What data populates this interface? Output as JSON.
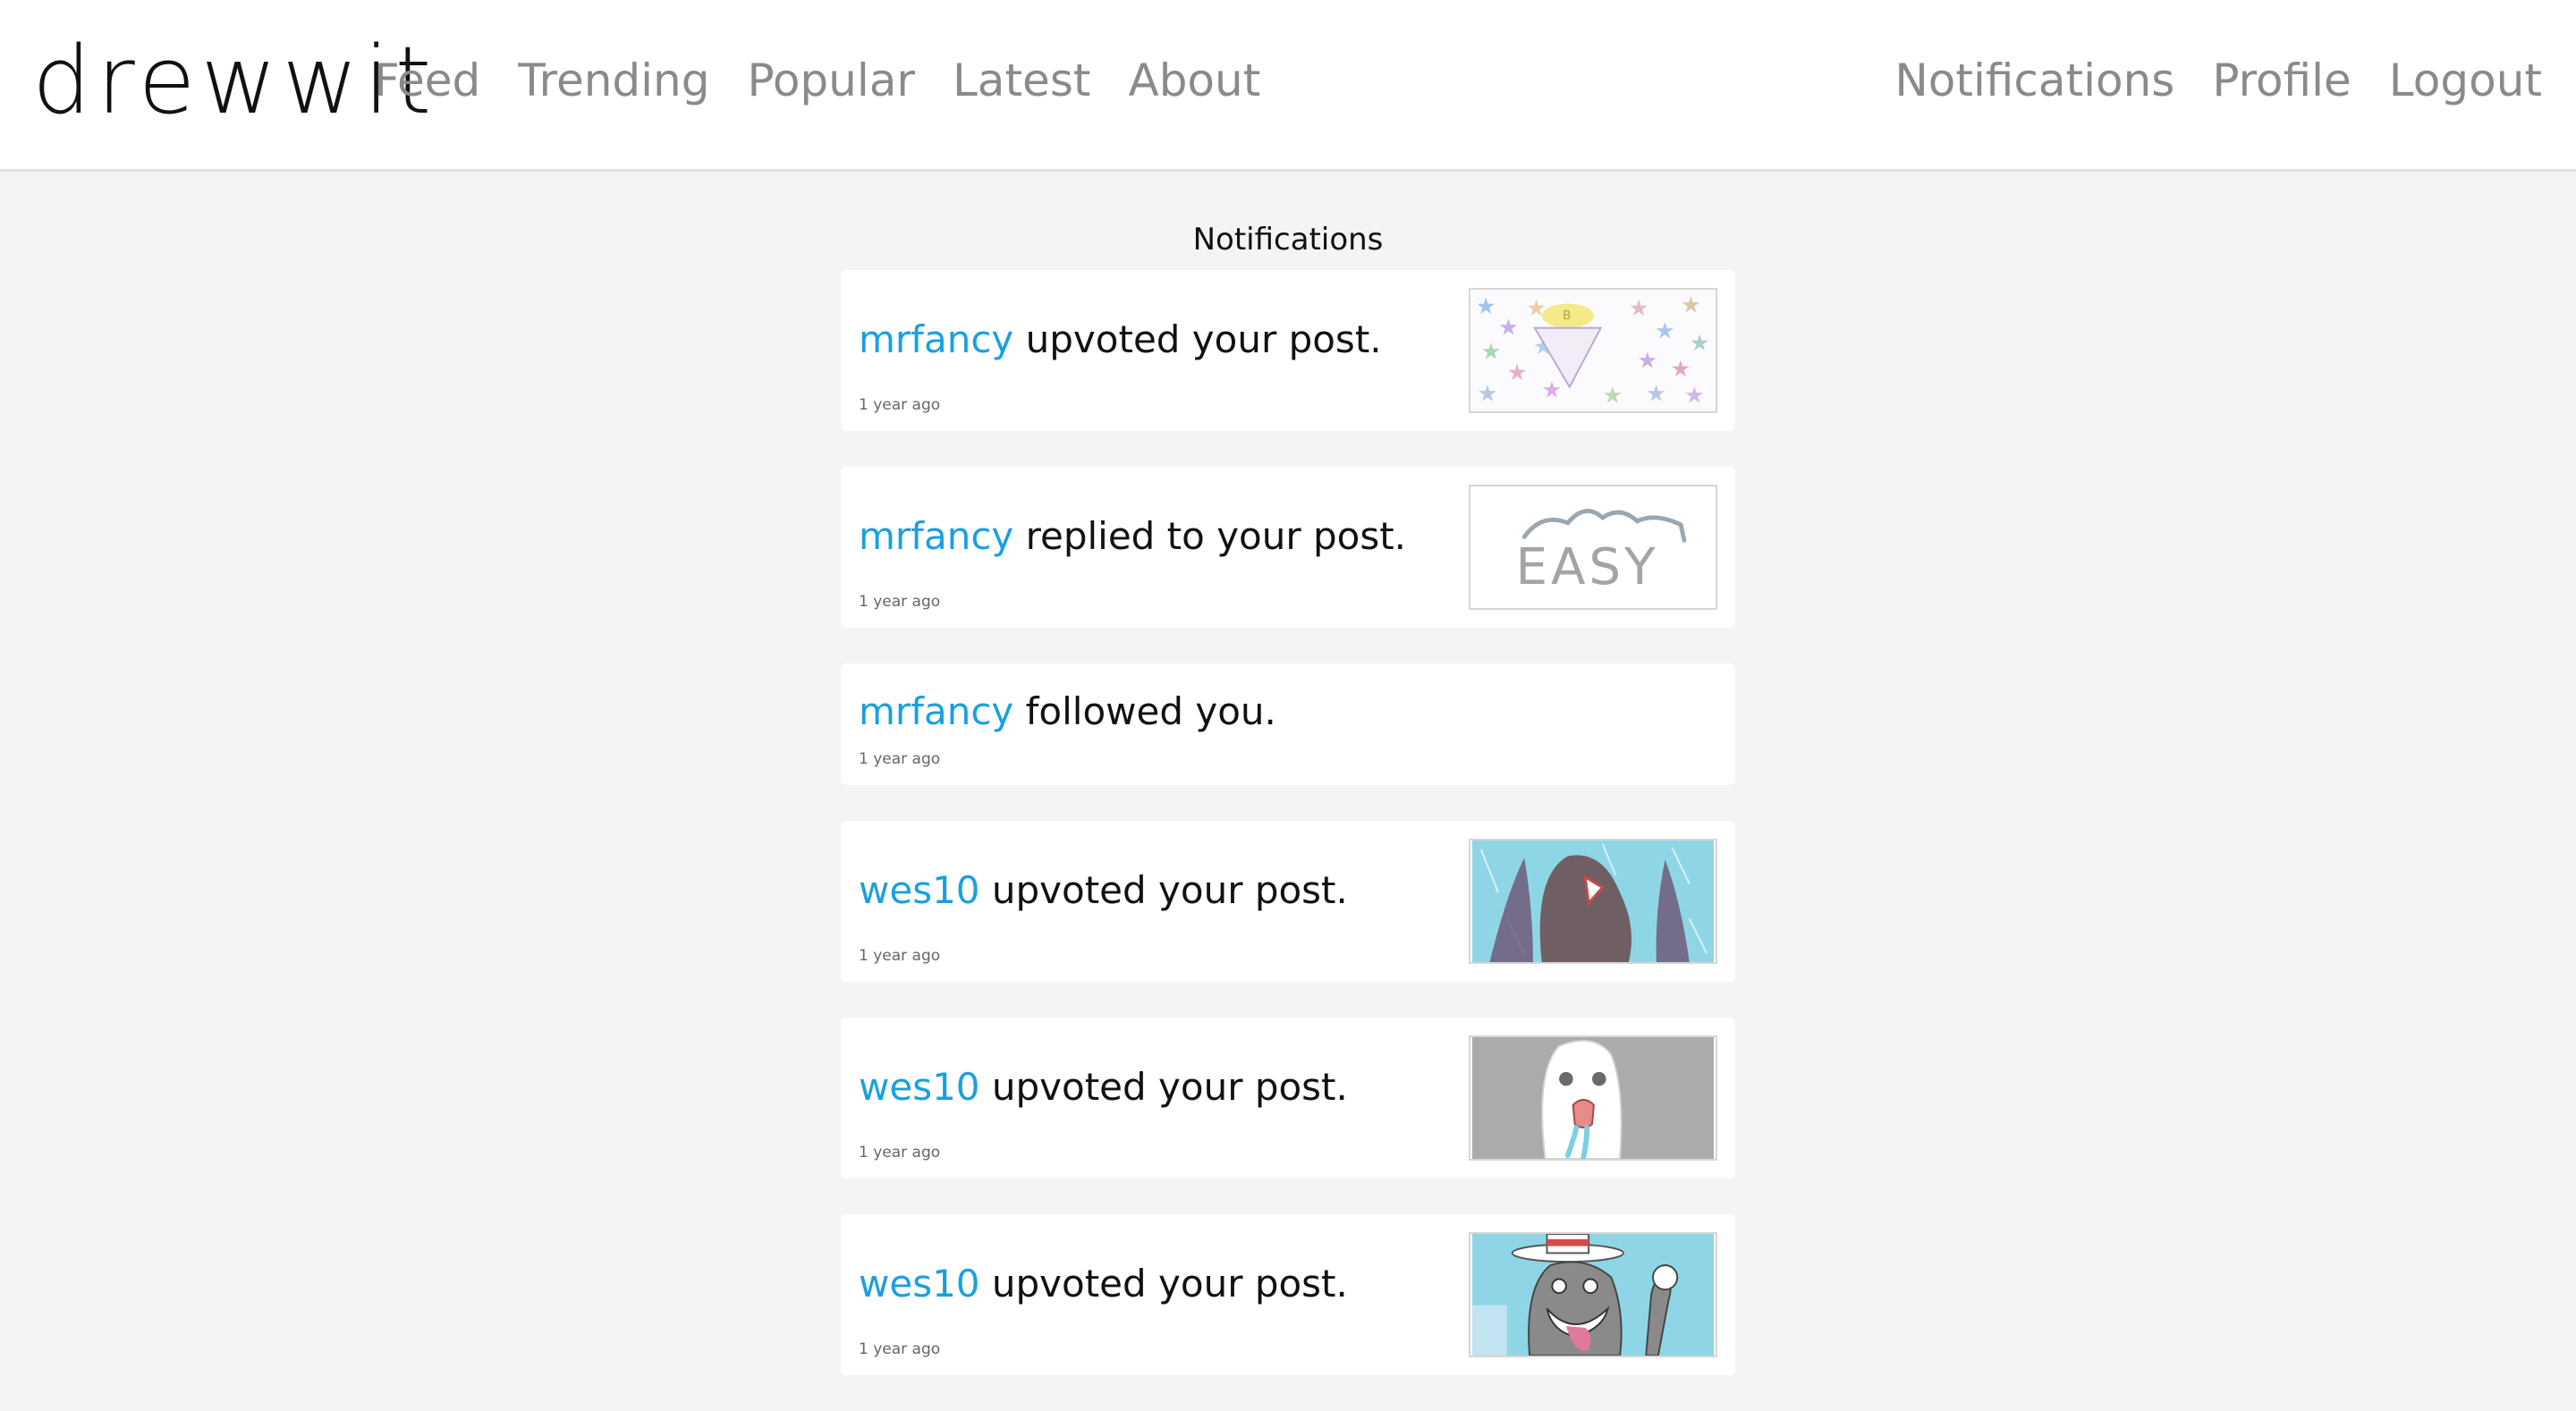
{
  "brand": {
    "name": "drewwit"
  },
  "nav": {
    "left": [
      "Feed",
      "Trending",
      "Popular",
      "Latest",
      "About"
    ],
    "right": [
      "Notifications",
      "Profile",
      "Logout"
    ]
  },
  "page": {
    "title": "Notifications"
  },
  "notifications": [
    {
      "user": "mrfancy",
      "action": "upvoted your post.",
      "time": "1 year ago",
      "thumb": "stars-cone-drawing"
    },
    {
      "user": "mrfancy",
      "action": "replied to your post.",
      "time": "1 year ago",
      "thumb": "easy-drawing"
    },
    {
      "user": "mrfancy",
      "action": "followed you.",
      "time": "1 year ago"
    },
    {
      "user": "wes10",
      "action": "upvoted your post.",
      "time": "1 year ago",
      "thumb": "walrus-drawing"
    },
    {
      "user": "wes10",
      "action": "upvoted your post.",
      "time": "1 year ago",
      "thumb": "ghost-face-drawing"
    },
    {
      "user": "wes10",
      "action": "upvoted your post.",
      "time": "1 year ago",
      "thumb": "cat-in-hat-drawing"
    }
  ],
  "thumb_text": {
    "easy": "EASY"
  },
  "colors": {
    "username": "#1aa0e0",
    "nav_link": "#8a8a8a",
    "background": "#f4f4f4",
    "card": "#ffffff"
  }
}
